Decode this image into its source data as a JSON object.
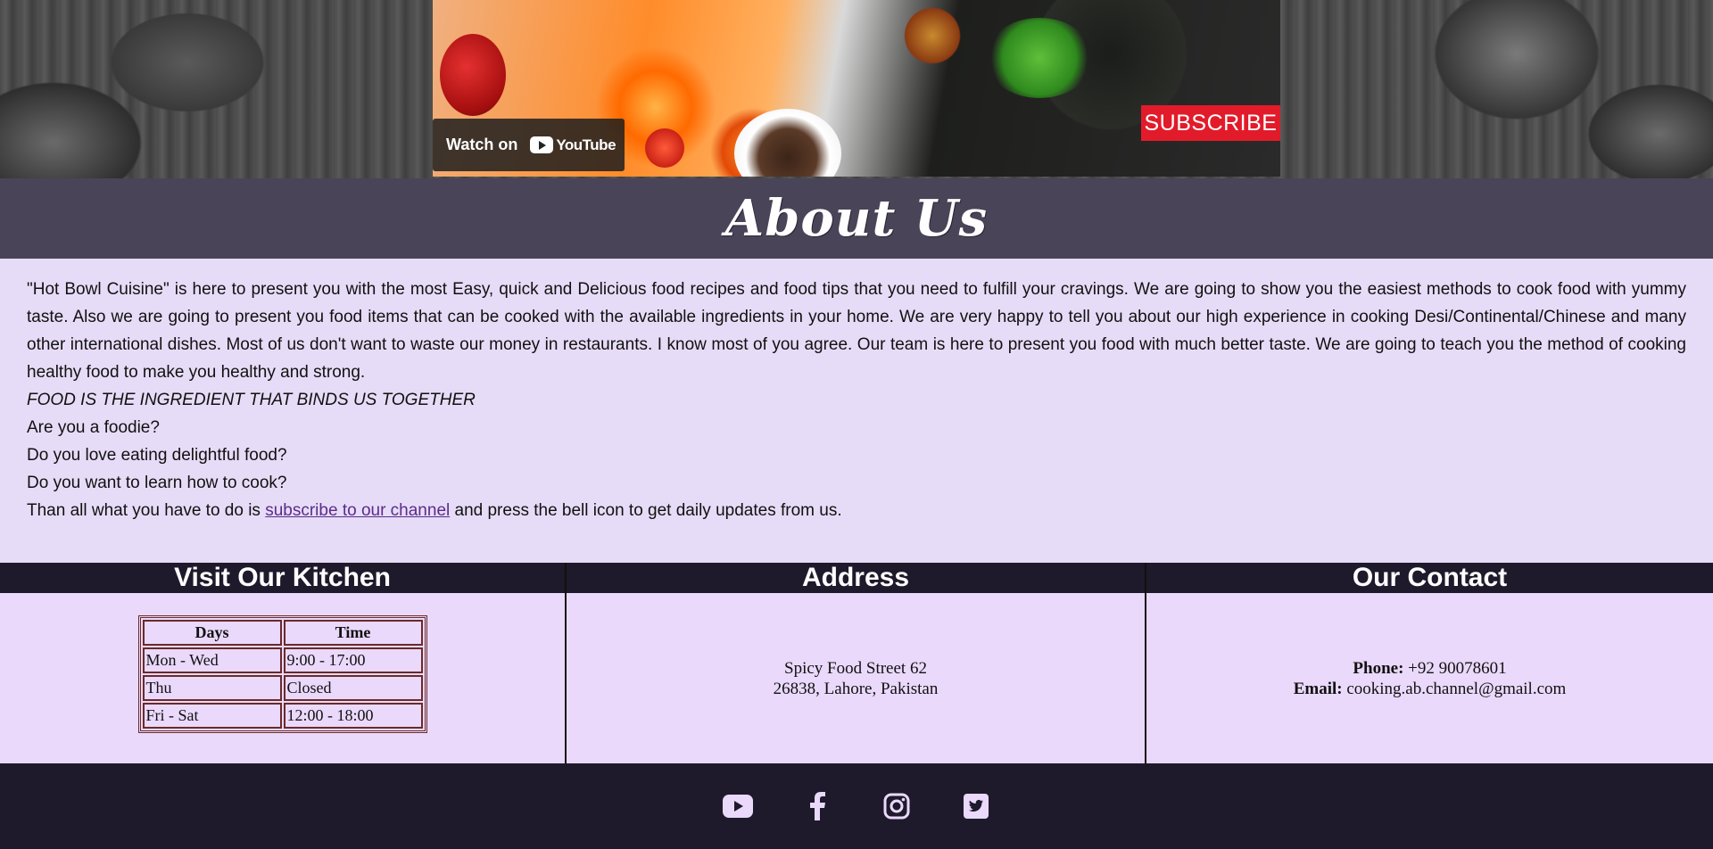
{
  "hero": {
    "watch_label": "Watch on",
    "youtube_label": "YouTube",
    "subscribe_label": "SUBSCRIBE"
  },
  "about": {
    "title": "About Us",
    "intro": "\"Hot Bowl Cuisine\" is here to present you with the most Easy, quick and Delicious food recipes and food tips that you need to fulfill your cravings. We are going to show you the easiest methods to cook food with yummy taste. Also we are going to present you food items that can be cooked with the available ingredients in your home. We are very happy to tell you about our high experience in cooking Desi/Continental/Chinese and many other international dishes. Most of us don't want to waste our money in restaurants. I know most of you agree. Our team is here to present you food with much better taste. We are going to teach you the method of cooking healthy food to make you healthy and strong.",
    "motto": "FOOD IS THE INGREDIENT THAT BINDS US TOGETHER",
    "questions": [
      "Are you a foodie?",
      "Do you love eating delightful food?",
      "Do you want to learn how to cook?"
    ],
    "cta_before": "Than all what you have to do is ",
    "cta_link": "subscribe to our channel",
    "cta_after": " and press the bell icon to get daily updates from us."
  },
  "kitchen": {
    "heading": "Visit Our Kitchen",
    "headers": [
      "Days",
      "Time"
    ],
    "rows": [
      [
        "Mon - Wed",
        "9:00 - 17:00"
      ],
      [
        "Thu",
        "Closed"
      ],
      [
        "Fri - Sat",
        "12:00 - 18:00"
      ]
    ]
  },
  "address": {
    "heading": "Address",
    "line1": "Spicy Food Street 62",
    "line2": "26838, Lahore, Pakistan"
  },
  "contact": {
    "heading": "Our Contact",
    "phone_label": "Phone:",
    "phone": " +92 90078601",
    "email_label": "Email:",
    "email": " cooking.ab.channel@gmail.com"
  },
  "footer": {
    "icons": [
      "youtube-icon",
      "facebook-icon",
      "instagram-icon",
      "twitter-icon"
    ],
    "icon_color": "#ead9fb",
    "background": "#1e1a2b"
  }
}
